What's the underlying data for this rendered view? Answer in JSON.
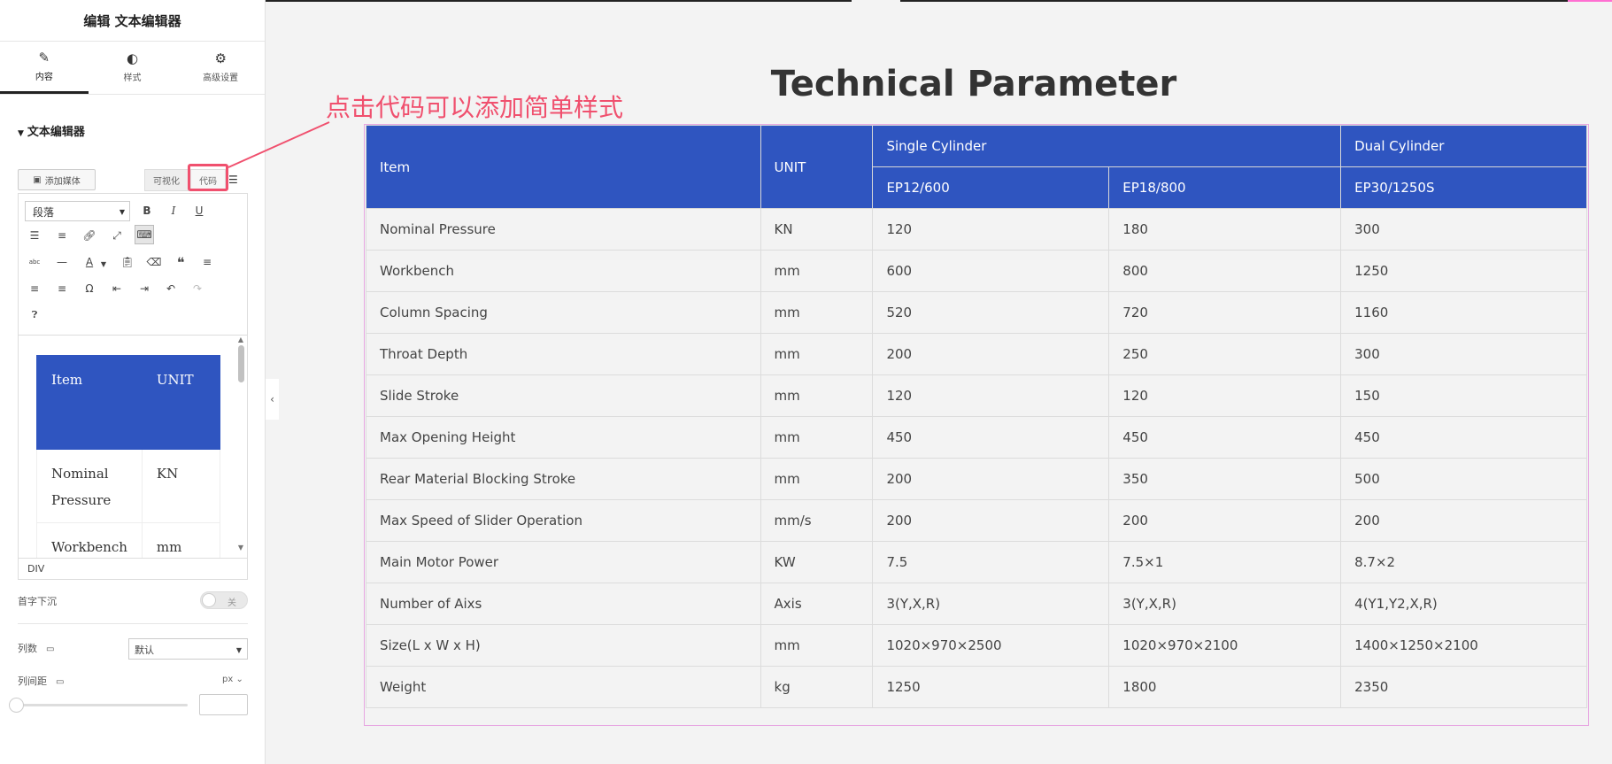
{
  "panel": {
    "title": "编辑 文本编辑器",
    "tabs": [
      {
        "label": "内容",
        "icon": "pencil-icon"
      },
      {
        "label": "样式",
        "icon": "half-circle-icon"
      },
      {
        "label": "高级设置",
        "icon": "gear-icon"
      }
    ],
    "section_title": "文本编辑器",
    "add_media_label": "添加媒体",
    "mode_visual_label": "可视化",
    "mode_code_label": "代码",
    "format_select_value": "段落",
    "preview_rows": [
      {
        "item": "Item",
        "unit": "UNIT"
      },
      {
        "item": "Nominal Pressure",
        "unit": "KN"
      },
      {
        "item": "Workbench",
        "unit": "mm"
      }
    ],
    "status_path": "DIV",
    "drop_cap_label": "首字下沉",
    "drop_cap_toggle_label": "关",
    "columns_label": "列数",
    "columns_value": "默认",
    "column_gap_label": "列间距",
    "column_gap_unit": "px ⌄"
  },
  "annotation": "点击代码可以添加简单样式",
  "main": {
    "title": "Technical Parameter",
    "table": {
      "header": {
        "item": "Item",
        "unit": "UNIT",
        "group1": "Single Cylinder",
        "group2": "Dual Cylinder",
        "models": [
          "EP12/600",
          "EP18/800",
          "EP30/1250S"
        ]
      },
      "rows": [
        [
          "Nominal Pressure",
          "KN",
          "120",
          "180",
          "300"
        ],
        [
          "Workbench",
          "mm",
          "600",
          "800",
          "1250"
        ],
        [
          "Column Spacing",
          "mm",
          "520",
          "720",
          "1160"
        ],
        [
          "Throat Depth",
          "mm",
          "200",
          "250",
          "300"
        ],
        [
          "Slide Stroke",
          "mm",
          "120",
          "120",
          "150"
        ],
        [
          "Max Opening Height",
          "mm",
          "450",
          "450",
          "450"
        ],
        [
          "Rear Material Blocking Stroke",
          "mm",
          "200",
          "350",
          "500"
        ],
        [
          "Max Speed of Slider Operation",
          "mm/s",
          "200",
          "200",
          "200"
        ],
        [
          "Main Motor Power",
          "KW",
          "7.5",
          "7.5×1",
          "8.7×2"
        ],
        [
          "Number of Aixs",
          "Axis",
          "3(Y,X,R)",
          "3(Y,X,R)",
          "4(Y1,Y2,X,R)"
        ],
        [
          "Size(L x W x H)",
          "mm",
          "1020×970×2500",
          "1020×970×2100",
          "1400×1250×2100"
        ],
        [
          "Weight",
          "kg",
          "1250",
          "1800",
          "2350"
        ]
      ]
    }
  },
  "colors": {
    "header_blue": "#2f55c0",
    "annotation_red": "#f0506e",
    "frame_pink": "#e7a6e2"
  }
}
